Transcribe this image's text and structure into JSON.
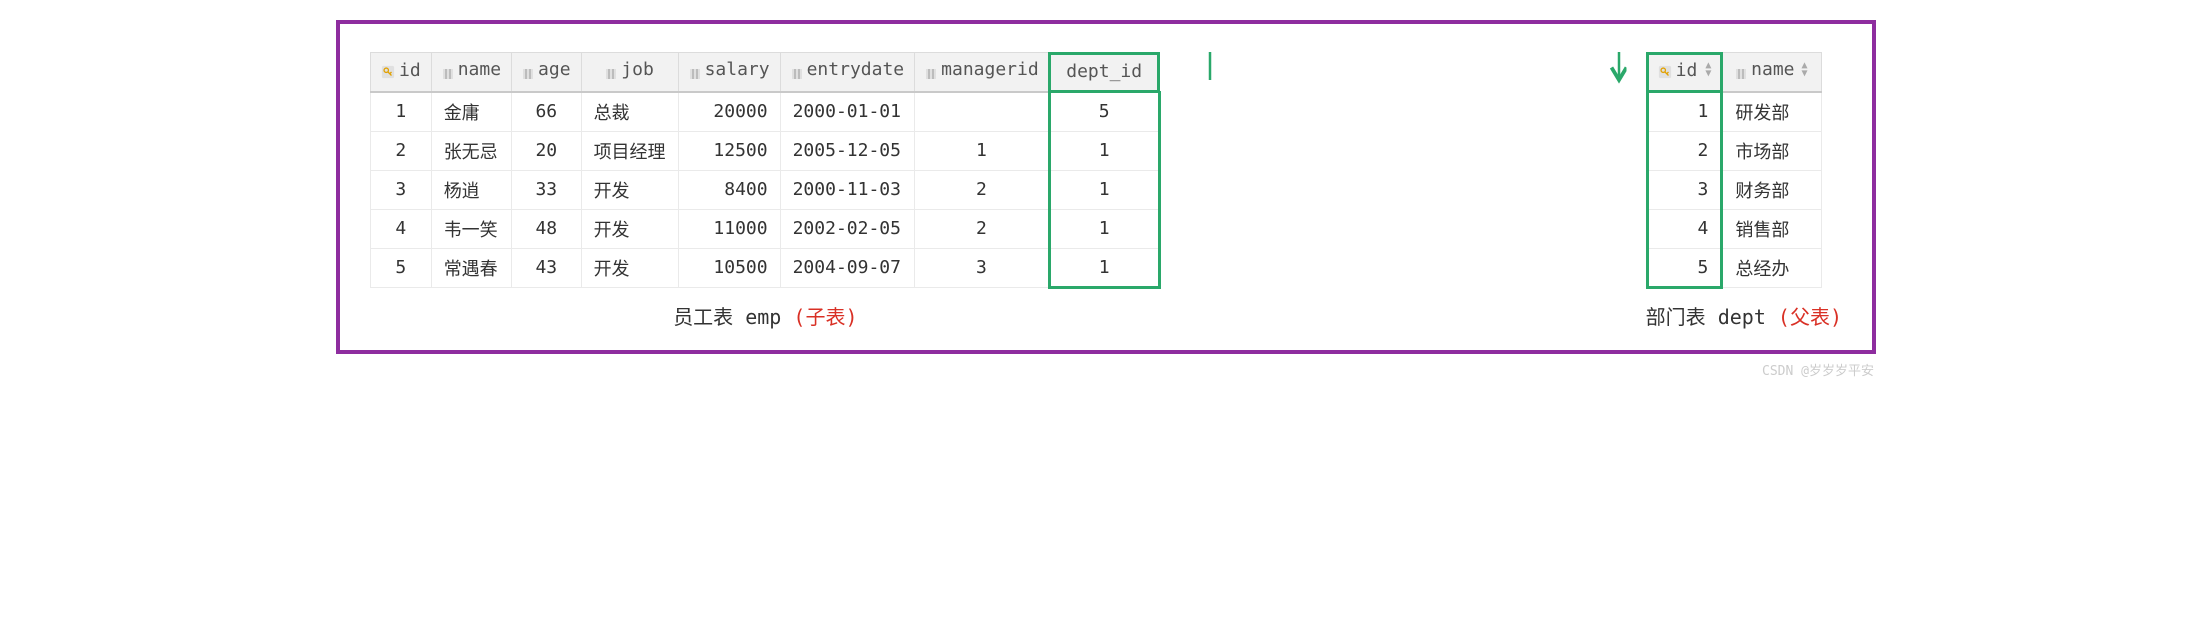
{
  "emp": {
    "headers": {
      "id": "id",
      "name": "name",
      "age": "age",
      "job": "job",
      "salary": "salary",
      "entrydate": "entrydate",
      "managerid": "managerid",
      "dept_id": "dept_id"
    },
    "rows": [
      {
        "id": "1",
        "name": "金庸",
        "age": "66",
        "job": "总裁",
        "salary": "20000",
        "entrydate": "2000-01-01",
        "managerid": "<null>",
        "managerid_null": true,
        "dept_id": "5"
      },
      {
        "id": "2",
        "name": "张无忌",
        "age": "20",
        "job": "项目经理",
        "salary": "12500",
        "entrydate": "2005-12-05",
        "managerid": "1",
        "dept_id": "1"
      },
      {
        "id": "3",
        "name": "杨逍",
        "age": "33",
        "job": "开发",
        "salary": "8400",
        "entrydate": "2000-11-03",
        "managerid": "2",
        "dept_id": "1"
      },
      {
        "id": "4",
        "name": "韦一笑",
        "age": "48",
        "job": "开发",
        "salary": "11000",
        "entrydate": "2002-02-05",
        "managerid": "2",
        "dept_id": "1"
      },
      {
        "id": "5",
        "name": "常遇春",
        "age": "43",
        "job": "开发",
        "salary": "10500",
        "entrydate": "2004-09-07",
        "managerid": "3",
        "dept_id": "1"
      }
    ],
    "caption_plain": "员工表 emp ",
    "caption_red": "(子表)"
  },
  "dept": {
    "headers": {
      "id": "id",
      "name": "name"
    },
    "rows": [
      {
        "id": "1",
        "name": "研发部"
      },
      {
        "id": "2",
        "name": "市场部"
      },
      {
        "id": "3",
        "name": "财务部"
      },
      {
        "id": "4",
        "name": "销售部"
      },
      {
        "id": "5",
        "name": "总经办"
      }
    ],
    "caption_plain": "部门表 dept ",
    "caption_red": "(父表)"
  },
  "watermark": "CSDN @岁岁岁平安",
  "colors": {
    "frame": "#8e2d9f",
    "highlight": "#2aa86a",
    "red": "#d93025"
  }
}
